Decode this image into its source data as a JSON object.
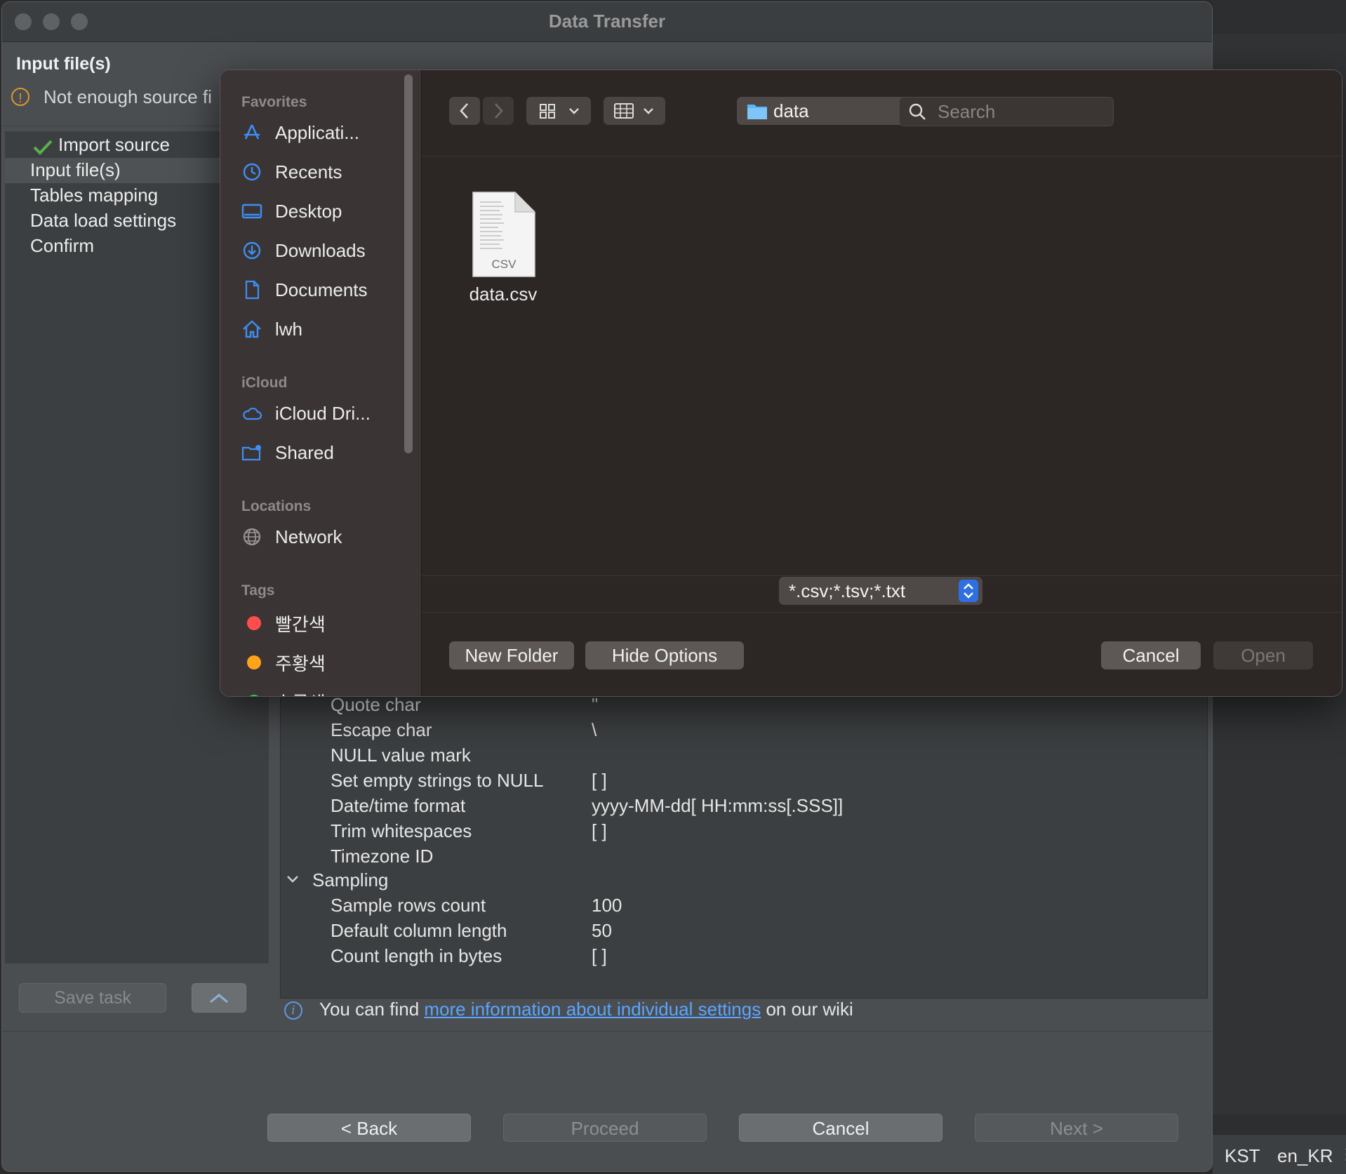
{
  "background": {
    "status_timezone": "KST",
    "status_locale": "en_KR",
    "status_grip": "⋮"
  },
  "window": {
    "title": "Data Transfer",
    "page_heading": "Input file(s)",
    "warning": "Not enough source fi",
    "nav": {
      "items": [
        "Import source",
        "Input file(s)",
        "Tables mapping",
        "Data load settings",
        "Confirm"
      ],
      "selected": "Input file(s)"
    },
    "save_task_label": "Save task",
    "properties": [
      {
        "name": "Quote char",
        "value": "\""
      },
      {
        "name": "Escape char",
        "value": "\\"
      },
      {
        "name": "NULL value mark",
        "value": ""
      },
      {
        "name": "Set empty strings to NULL",
        "value": "[ ]"
      },
      {
        "name": "Date/time format",
        "value": "yyyy-MM-dd[ HH:mm:ss[.SSS]]"
      },
      {
        "name": "Trim whitespaces",
        "value": "[ ]"
      },
      {
        "name": "Timezone ID",
        "value": ""
      }
    ],
    "sampling": {
      "label": "Sampling",
      "properties": [
        {
          "name": "Sample rows count",
          "value": "100"
        },
        {
          "name": "Default column length",
          "value": "50"
        },
        {
          "name": "Count length in bytes",
          "value": "[ ]"
        }
      ]
    },
    "info": {
      "prefix": "You can find ",
      "link": "more information about individual settings",
      "suffix": " on our wiki"
    },
    "footer": {
      "back": "< Back",
      "proceed": "Proceed",
      "cancel": "Cancel",
      "next": "Next >"
    }
  },
  "dialog": {
    "sidebar": {
      "favorites_title": "Favorites",
      "favorites": [
        {
          "label": "Applicati...",
          "icon": "applications-icon"
        },
        {
          "label": "Recents",
          "icon": "recents-icon"
        },
        {
          "label": "Desktop",
          "icon": "desktop-icon"
        },
        {
          "label": "Downloads",
          "icon": "downloads-icon"
        },
        {
          "label": "Documents",
          "icon": "documents-icon"
        },
        {
          "label": "lwh",
          "icon": "home-icon"
        }
      ],
      "icloud_title": "iCloud",
      "icloud": [
        {
          "label": "iCloud Dri...",
          "icon": "icloud-icon"
        },
        {
          "label": "Shared",
          "icon": "shared-folder-icon"
        }
      ],
      "locations_title": "Locations",
      "locations": [
        {
          "label": "Network",
          "icon": "network-icon"
        }
      ],
      "tags_title": "Tags",
      "tags": [
        {
          "label": "빨간색",
          "color": "#ff4d4d"
        },
        {
          "label": "주황색",
          "color": "#ffa31a"
        },
        {
          "label": "초록색",
          "color": "#34c759"
        }
      ]
    },
    "toolbar": {
      "current_folder": "data",
      "search_placeholder": "Search"
    },
    "files": [
      {
        "name": "data.csv",
        "badge": "CSV"
      }
    ],
    "file_type_filter": "*.csv;*.tsv;*.txt",
    "buttons": {
      "new_folder": "New Folder",
      "hide_options": "Hide Options",
      "cancel": "Cancel",
      "open": "Open"
    }
  }
}
